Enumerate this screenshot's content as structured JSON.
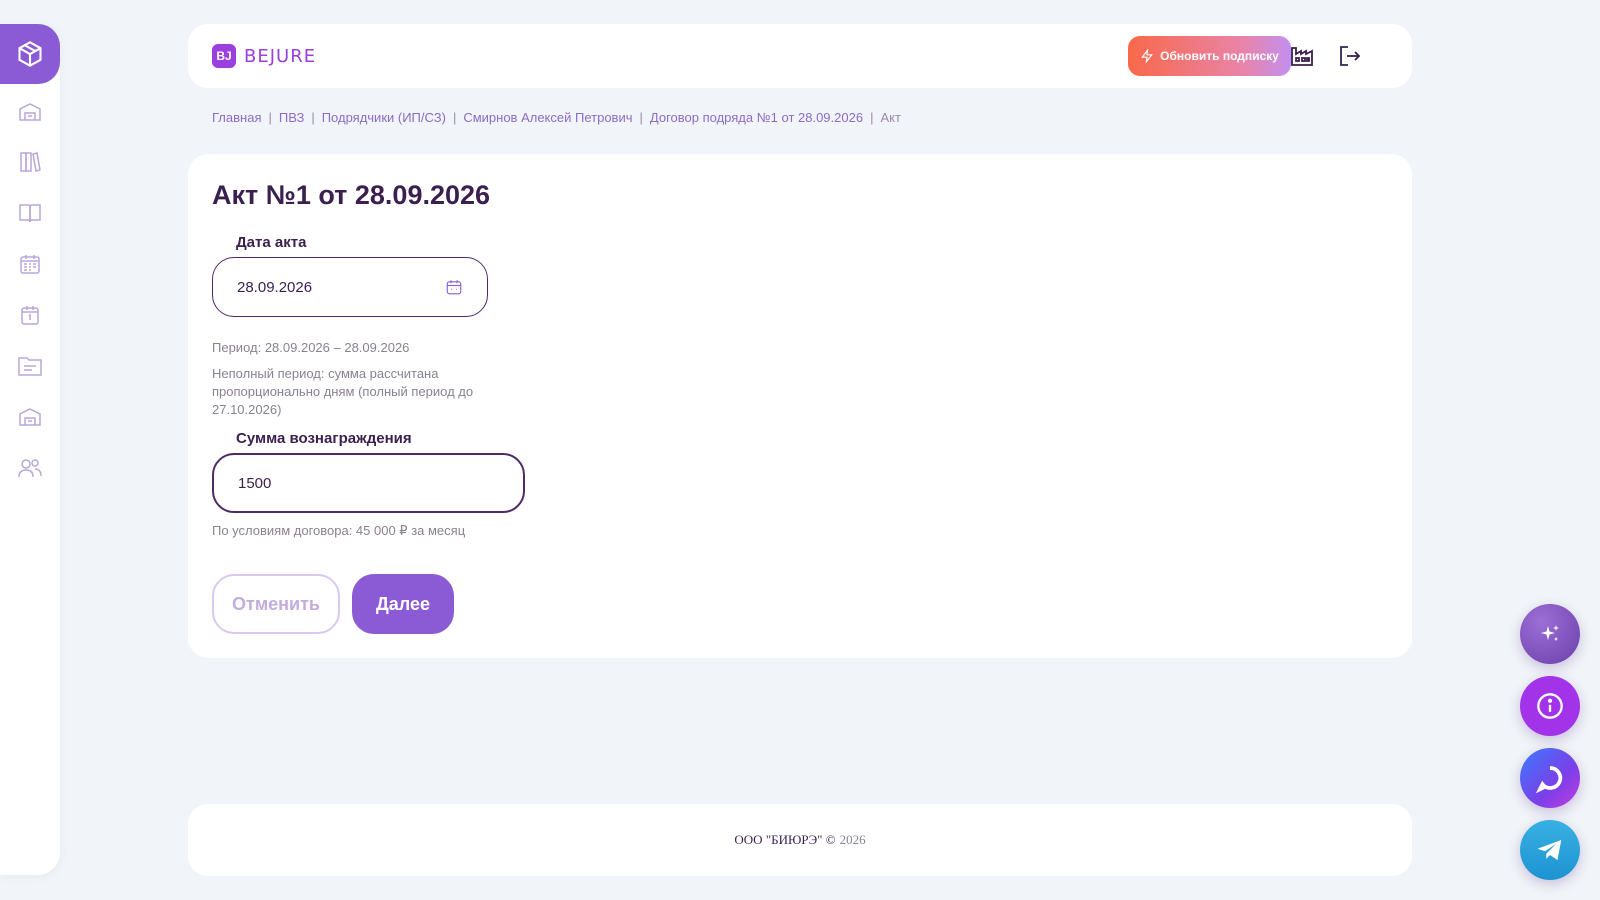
{
  "brand": {
    "mark": "BJ",
    "name": "BEJURE"
  },
  "header": {
    "upgrade_label": "Обновить подписку",
    "icons": [
      "factory-icon",
      "logout-icon"
    ]
  },
  "sidebar": {
    "items": [
      {
        "icon": "box-icon",
        "active": true
      },
      {
        "icon": "warehouse-icon"
      },
      {
        "icon": "book-shelf-icon"
      },
      {
        "icon": "open-book-icon"
      },
      {
        "icon": "calendar-grid-icon"
      },
      {
        "icon": "calendar-day-icon"
      },
      {
        "icon": "folder-icon"
      },
      {
        "icon": "warehouse-icon"
      },
      {
        "icon": "users-icon"
      }
    ]
  },
  "breadcrumb": [
    "Главная",
    "ПВЗ",
    "Подрядчики (ИП/СЗ)",
    "Смирнов Алексей Петрович",
    "Договор подряда №1 от 28.09.2026",
    "Акт"
  ],
  "breadcrumb_separator": "|",
  "form": {
    "title": "Акт №1 от 28.09.2026",
    "date_label": "Дата акта",
    "date_value": "28.09.2026",
    "period_text": "Период: 28.09.2026 – 28.09.2026",
    "partial_period_text": "Неполный период: сумма рассчитана пропорционально дням (полный период до 27.10.2026)",
    "amount_label": "Сумма вознаграждения",
    "amount_value": "1500",
    "contract_terms_text": "По условиям договора: 45 000 ₽ за месяц",
    "cancel_label": "Отменить",
    "next_label": "Далее"
  },
  "footer": {
    "company": "ООО \"БИЮРЭ\" ©",
    "year": "2026"
  },
  "floating_buttons": [
    "sparkle-icon",
    "info-icon",
    "chat-icon",
    "telegram-icon"
  ],
  "colors": {
    "accent": "#8b5bd6",
    "text_dark": "#3b1f4f",
    "background": "#f1f4f8",
    "upgrade_gradient_start": "#f9684a",
    "upgrade_gradient_end": "#c48ff0"
  }
}
